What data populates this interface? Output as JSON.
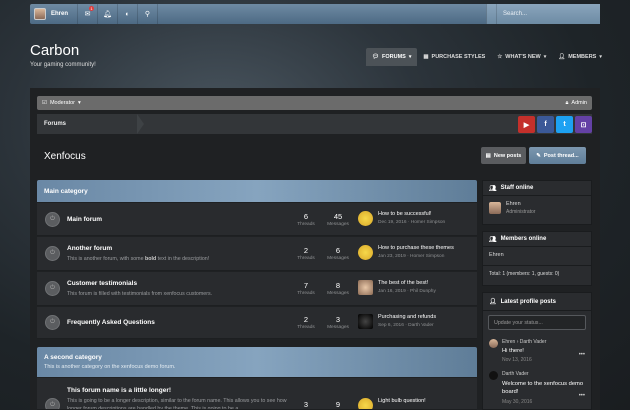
{
  "topbar": {
    "username": "Ehren",
    "search_placeholder": "Search...",
    "alerts_count": "1"
  },
  "site": {
    "title": "Carbon",
    "subtitle": "Your gaming community!"
  },
  "nav": {
    "tabs": [
      {
        "label": "Forums"
      },
      {
        "label": "Purchase styles"
      },
      {
        "label": "What's new"
      },
      {
        "label": "Members"
      }
    ]
  },
  "modbar": {
    "moderator": "Moderator",
    "admin": "Admin"
  },
  "breadcrumb": {
    "current": "Forums"
  },
  "social": {
    "youtube": "▶",
    "facebook": "f",
    "twitter": "t",
    "twitch": "⊡"
  },
  "page": {
    "title": "Xenfocus",
    "new_posts": "New posts",
    "post_thread": "Post thread..."
  },
  "categories": [
    {
      "title": "Main category",
      "desc": "",
      "forums": [
        {
          "title": "Main forum",
          "desc": "",
          "threads": "6",
          "messages": "45",
          "last_title": "How to be successful!",
          "last_meta": "Dec 19, 2016 · Homer Simpson"
        },
        {
          "title": "Another forum",
          "desc_pre": "This is another forum, with some ",
          "desc_bold": "bold",
          "desc_post": " text in the description!",
          "threads": "2",
          "messages": "6",
          "last_title": "How to purchase these themes",
          "last_meta": "Jan 23, 2019 · Homer Simpson"
        },
        {
          "title": "Customer testimonials",
          "desc": "This forum is filled with testimonials from xenfocus customers.",
          "threads": "7",
          "messages": "8",
          "last_title": "The best of the best!",
          "last_meta": "Jan 16, 2019 · Phil Dunphy"
        },
        {
          "title": "Frequently Asked Questions",
          "desc": "",
          "threads": "2",
          "messages": "3",
          "last_title": "Purchasing and refunds",
          "last_meta": "Sep 6, 2016 · Darth Vader"
        }
      ]
    },
    {
      "title": "A second category",
      "desc": "This is another category on the xenfocus demo forum.",
      "forums": [
        {
          "title": "This forum name is a little longer!",
          "desc": "This is going to be a longer description, similar to the forum name. This allows you to see how longer forum descriptions are handled by the theme. This is going to be a",
          "threads": "3",
          "messages": "9",
          "last_title": "Light bulb question!",
          "last_meta": ""
        }
      ]
    }
  ],
  "thread_label": "Threads",
  "messages_label": "Messages",
  "sidebar": {
    "staff": {
      "title": "Staff online",
      "name": "Ehren",
      "role": "Administrator"
    },
    "members": {
      "title": "Members online",
      "list": "Ehren",
      "total": "Total: 1 (members: 1, guests: 0)"
    },
    "profile": {
      "title": "Latest profile posts",
      "placeholder": "Update your status...",
      "posts": [
        {
          "author": "Ehren › Darth Vader",
          "text": "Hi there!",
          "date": "Nov 13, 2016"
        },
        {
          "author": "Darth Vader",
          "text": "Welcome to the xenfocus demo board!",
          "date": "May 30, 2016"
        }
      ]
    }
  },
  "colors": {
    "accent": "#6a88a5",
    "youtube": "#c4302b",
    "facebook": "#3b5998",
    "twitter": "#1da1f2",
    "twitch": "#6441a5"
  }
}
